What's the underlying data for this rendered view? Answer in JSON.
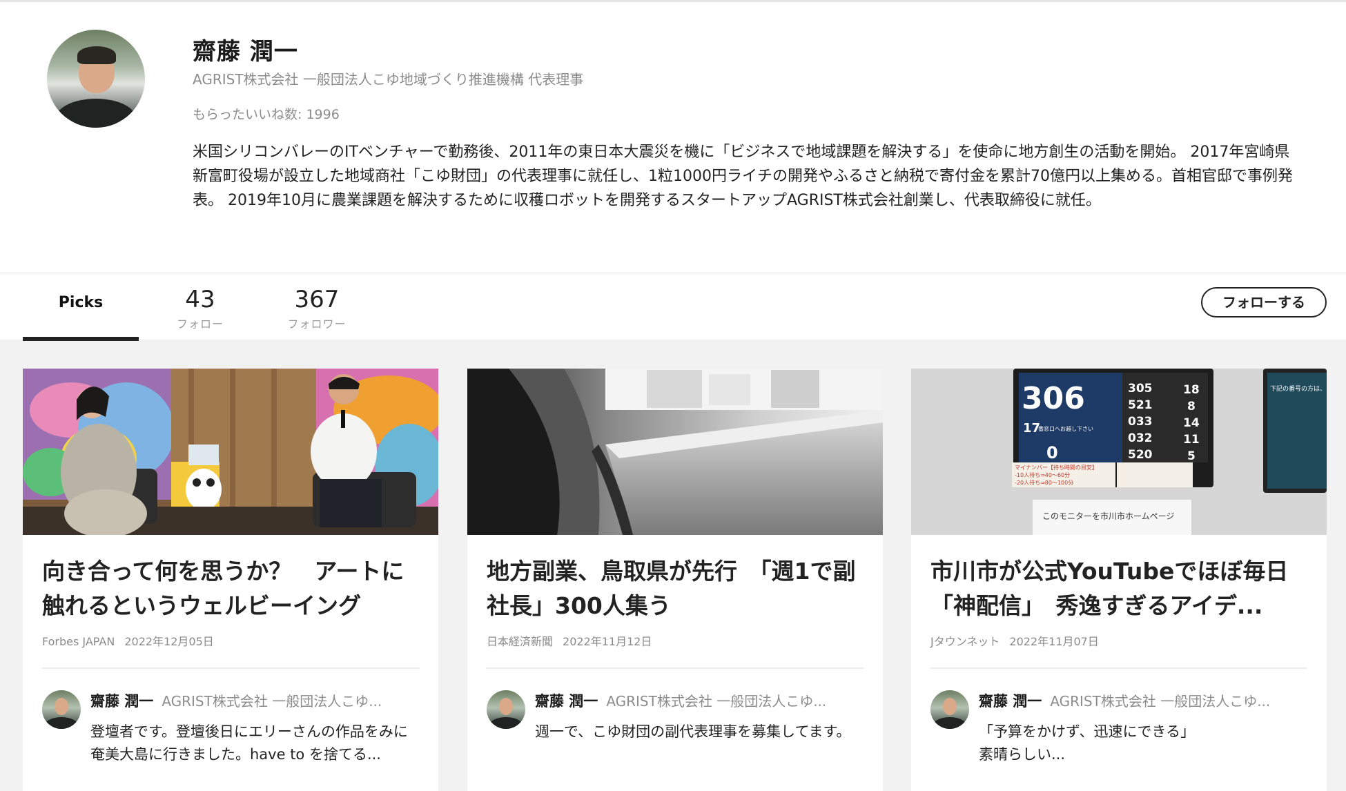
{
  "profile": {
    "name": "齋藤 潤一",
    "affiliation": "AGRIST株式会社 一般団法人こゆ地域づくり推進機構 代表理事",
    "likes": "もらったいいね数: 1996",
    "bio": "米国シリコンバレーのITベンチャーで勤務後、2011年の東日本大震災を機に「ビジネスで地域課題を解決する」を使命に地方創生の活動を開始。 2017年宮崎県新富町役場が設立した地域商社「こゆ財団」の代表理事に就任し、1粒1000円ライチの開発やふるさと納税で寄付金を累計70億円以上集める。首相官邸で事例発表。 2019年10月に農業課題を解決するために収穫ロボットを開発するスタートアップAGRIST株式会社創業し、代表取締役に就任。"
  },
  "tabs": {
    "picks_label": "Picks",
    "follow_count": "43",
    "follow_label": "フォロー",
    "follower_count": "367",
    "follower_label": "フォロワー",
    "follow_button": "フォローする"
  },
  "cards": [
    {
      "title": "向き合って何を思うか？　アートに触れるというウェルビーイング",
      "source": "Forbes JAPAN",
      "date": "2022年12月05日",
      "picker_name": "齋藤 潤一",
      "picker_affil": "AGRIST株式会社 一般団法人こゆ...",
      "comment": "登壇者です。登壇後日にエリーさんの作品をみに奄美大島に行きました。have to を捨てる..."
    },
    {
      "title": "地方副業、鳥取県が先行　「週1で副社長」300人集う",
      "source": "日本経済新聞",
      "date": "2022年11月12日",
      "picker_name": "齋藤 潤一",
      "picker_affil": "AGRIST株式会社 一般団法人こゆ...",
      "comment": "週一で、こゆ財団の副代表理事を募集してます。"
    },
    {
      "title": "市川市が公式YouTubeでほぼ毎日「神配信」　秀逸すぎるアイデ...",
      "source": "Jタウンネット",
      "date": "2022年11月07日",
      "picker_name": "齋藤 潤一",
      "picker_affil": "AGRIST株式会社 一般団法人こゆ...",
      "comment": "「予算をかけず、迅速にできる」\n素晴らしい..."
    }
  ],
  "photo3": {
    "big_number": "306",
    "counter_no": "17",
    "counter_text": "番窓口へお越し下さい",
    "zero": "0",
    "rows": [
      {
        "a": "305",
        "b": "18"
      },
      {
        "a": "521",
        "b": "8"
      },
      {
        "a": "033",
        "b": "14"
      },
      {
        "a": "032",
        "b": "11"
      },
      {
        "a": "520",
        "b": "5"
      }
    ],
    "notice1": "マイナンバー【待ち時間の目安】",
    "notice2": "-10人待ち⇒40〜60分",
    "notice3": "-20人待ち⇒80〜100分",
    "notice4": "このモニターを市川市ホームページ",
    "side_text": "下記の番号の方は、"
  },
  "colors": {
    "accent": "#222222",
    "muted": "#8c8c8c",
    "background": "#f2f2f2"
  }
}
